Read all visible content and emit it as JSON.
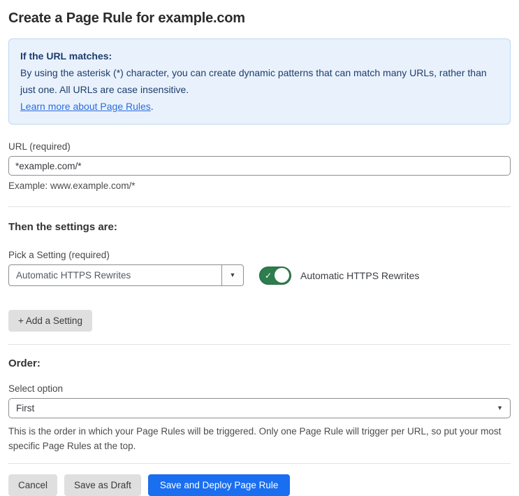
{
  "page": {
    "title": "Create a Page Rule for example.com"
  },
  "info_box": {
    "heading": "If the URL matches:",
    "body": "By using the asterisk (*) character, you can create dynamic patterns that can match many URLs, rather than just one. All URLs are case insensitive.",
    "link_text": "Learn more about Page Rules",
    "link_suffix": "."
  },
  "url_section": {
    "label": "URL (required)",
    "value": "*example.com/*",
    "helper": "Example: www.example.com/*"
  },
  "settings_section": {
    "heading": "Then the settings are:",
    "pick_label": "Pick a Setting (required)",
    "selected_setting": "Automatic HTTPS Rewrites",
    "toggle_state": "on",
    "toggle_check_icon": "✓",
    "toggle_label": "Automatic HTTPS Rewrites",
    "add_button_label": "+ Add a Setting",
    "dropdown_arrow_icon": "▼"
  },
  "order_section": {
    "heading": "Order:",
    "label": "Select option",
    "selected_option": "First",
    "dropdown_arrow_icon": "▼",
    "helper": "This is the order in which your Page Rules will be triggered. Only one Page Rule will trigger per URL, so put your most specific Page Rules at the top."
  },
  "footer": {
    "cancel_label": "Cancel",
    "save_draft_label": "Save as Draft",
    "save_deploy_label": "Save and Deploy Page Rule"
  },
  "colors": {
    "accent_blue": "#1a6ef0",
    "toggle_green": "#2e7d4c",
    "info_bg": "#e9f2fc",
    "info_border": "#bcd7f3",
    "info_text": "#1e3c6e",
    "link_blue": "#2b6cde"
  }
}
